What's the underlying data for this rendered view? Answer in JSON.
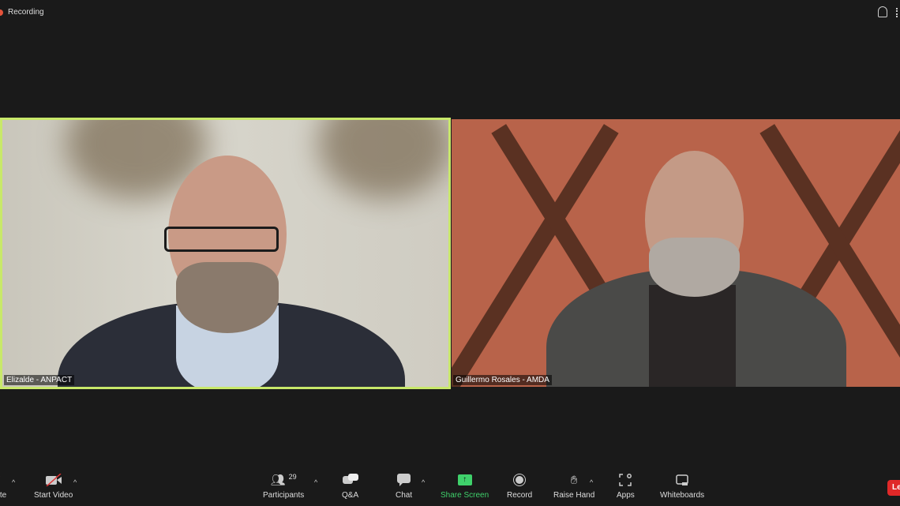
{
  "top": {
    "recording_label": "Recording"
  },
  "participants": [
    {
      "name": "Elizalde - ANPACT",
      "active_speaker": true,
      "border_color": "#c8e86a"
    },
    {
      "name": "Guillermo Rosales - AMDA",
      "active_speaker": false
    }
  ],
  "toolbar": {
    "mute": "Mute",
    "start_video": "Start Video",
    "participants": "Participants",
    "participants_count": "29",
    "qa": "Q&A",
    "chat": "Chat",
    "share_screen": "Share Screen",
    "record": "Record",
    "raise_hand": "Raise Hand",
    "apps": "Apps",
    "whiteboards": "Whiteboards",
    "leave": "Leave"
  },
  "colors": {
    "share_green": "#3fd16b",
    "leave_red": "#e02828",
    "recording_dot": "#e5533b"
  }
}
